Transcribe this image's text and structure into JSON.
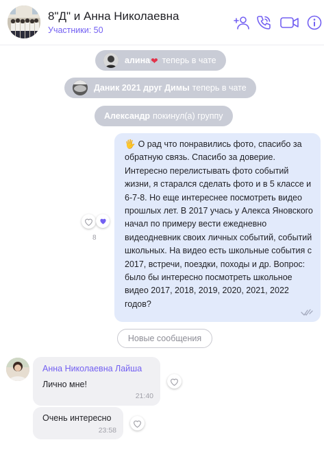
{
  "header": {
    "title": "8\"Д\" и Анна Николаевна",
    "subtitle": "Участники: 50",
    "icons": [
      "add-participant-icon",
      "phone-icon",
      "video-icon",
      "info-icon"
    ]
  },
  "system_messages": [
    {
      "name": "алина",
      "emoji": "❤",
      "text": "теперь в чате"
    },
    {
      "name": "Даник 2021 друг Димы",
      "text": "теперь в чате"
    },
    {
      "name": "Александр",
      "text": "покинул(а) группу"
    }
  ],
  "outgoing": {
    "emoji": "🖐",
    "text": "О рад что понравились фото, спасибо за обратную связь. Спасибо за доверие. Интересно перелистывать фото событий жизни, я старался сделать фото и в 5 классе и 6-7-8. Но еще интереснее посмотреть видео прошлых лет. В 2017 учась у Алекса Яновского начал по примеру вести ежедневно видеодневник своих личных событий, событий школьных. На видео есть школьные события с 2017, встречи, поездки, походы и др. Вопрос: было бы интересно посмотреть школьное видео 2017, 2018, 2019, 2020, 2021, 2022 годов?",
    "likes": "8"
  },
  "new_messages_label": "Новые сообщения",
  "incoming": [
    {
      "sender": "Анна Николаевна Лайша",
      "text": "Лично мне!",
      "time": "21:40"
    },
    {
      "text": "Очень интересно",
      "time": "23:58"
    }
  ],
  "colors": {
    "accent": "#7360f2",
    "system_pill": "#c9ccd6",
    "outgoing_bubble": "#e2eafb",
    "incoming_bubble": "#f0f0f3"
  }
}
